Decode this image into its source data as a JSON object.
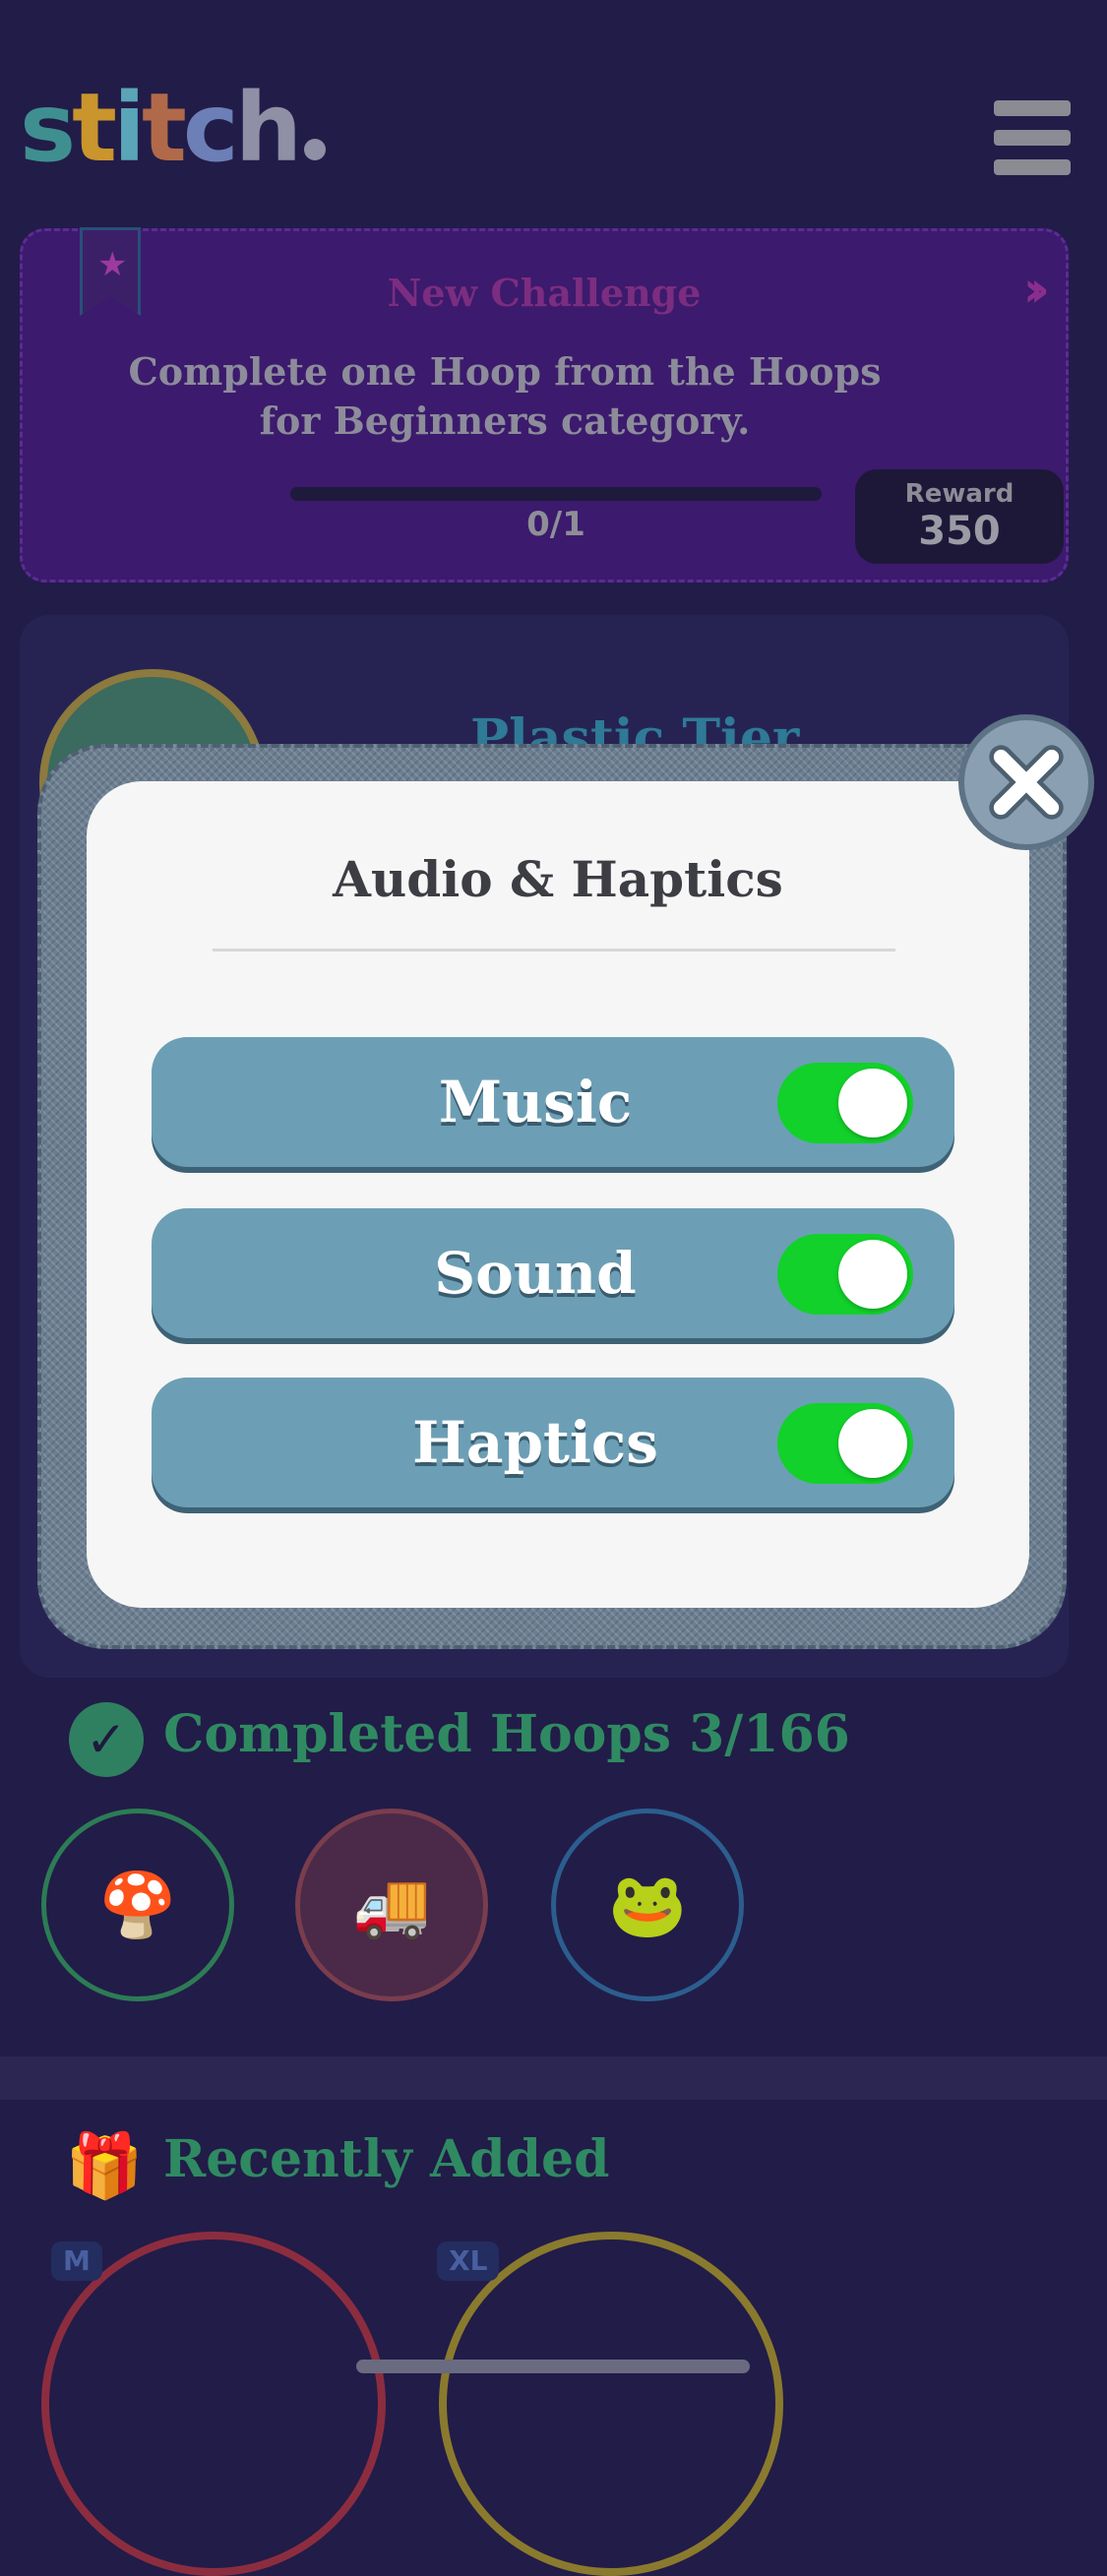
{
  "app": {
    "logo_text": "stitch"
  },
  "challenge": {
    "title": "New Challenge",
    "description": "Complete one Hoop from the Hoops for Beginners category.",
    "progress_text": "0/1",
    "progress_fraction": 0,
    "reward_label": "Reward",
    "reward_value": "350"
  },
  "tier": {
    "title": "Plastic Tier"
  },
  "completed": {
    "title": "Completed Hoops 3/166"
  },
  "recent": {
    "title": "Recently Added",
    "badges": [
      "M",
      "XL"
    ]
  },
  "modal": {
    "title": "Audio & Haptics",
    "toggles": [
      {
        "label": "Music",
        "on": true
      },
      {
        "label": "Sound",
        "on": true
      },
      {
        "label": "Haptics",
        "on": true
      }
    ]
  },
  "colors": {
    "background": "#221c48",
    "toggle_on": "#12d12a",
    "row_blue": "#6c9fb5",
    "challenge_purple": "#3c1a6d"
  },
  "icons": [
    "hamburger-menu-icon",
    "bookmark-star-icon",
    "double-chevron-right-icon",
    "check-circle-icon",
    "gift-box-icon",
    "close-icon"
  ]
}
